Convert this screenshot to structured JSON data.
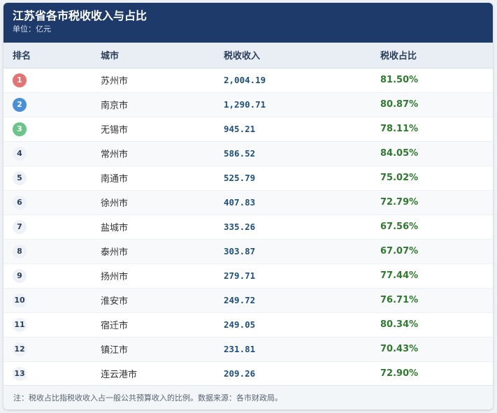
{
  "header": {
    "title": "江苏省各市税收收入与占比",
    "unit": "单位：亿元"
  },
  "columns": [
    "排名",
    "城市",
    "税收收入",
    "税收占比"
  ],
  "colors": {
    "header_bg": "#1d3a6b",
    "rank1": "#e57373",
    "rank2": "#4a8fd9",
    "rank3": "#6cc48a",
    "tax_text": "#1f4f7f",
    "ratio_text": "#2f7a2f"
  },
  "rows": [
    {
      "rank": "1",
      "city": "苏州市",
      "tax": "2,004.19",
      "ratio": "81.50%"
    },
    {
      "rank": "2",
      "city": "南京市",
      "tax": "1,290.71",
      "ratio": "80.87%"
    },
    {
      "rank": "3",
      "city": "无锡市",
      "tax": "945.21",
      "ratio": "78.11%"
    },
    {
      "rank": "4",
      "city": "常州市",
      "tax": "586.52",
      "ratio": "84.05%"
    },
    {
      "rank": "5",
      "city": "南通市",
      "tax": "525.79",
      "ratio": "75.02%"
    },
    {
      "rank": "6",
      "city": "徐州市",
      "tax": "407.83",
      "ratio": "72.79%"
    },
    {
      "rank": "7",
      "city": "盐城市",
      "tax": "335.26",
      "ratio": "67.56%"
    },
    {
      "rank": "8",
      "city": "泰州市",
      "tax": "303.87",
      "ratio": "67.07%"
    },
    {
      "rank": "9",
      "city": "扬州市",
      "tax": "279.71",
      "ratio": "77.44%"
    },
    {
      "rank": "10",
      "city": "淮安市",
      "tax": "249.72",
      "ratio": "76.71%"
    },
    {
      "rank": "11",
      "city": "宿迁市",
      "tax": "249.05",
      "ratio": "80.34%"
    },
    {
      "rank": "12",
      "city": "镇江市",
      "tax": "231.81",
      "ratio": "70.43%"
    },
    {
      "rank": "13",
      "city": "连云港市",
      "tax": "209.26",
      "ratio": "72.90%"
    }
  ],
  "footnote": "注：税收占比指税收收入占一般公共预算收入的比例。数据来源：各市财政局。"
}
